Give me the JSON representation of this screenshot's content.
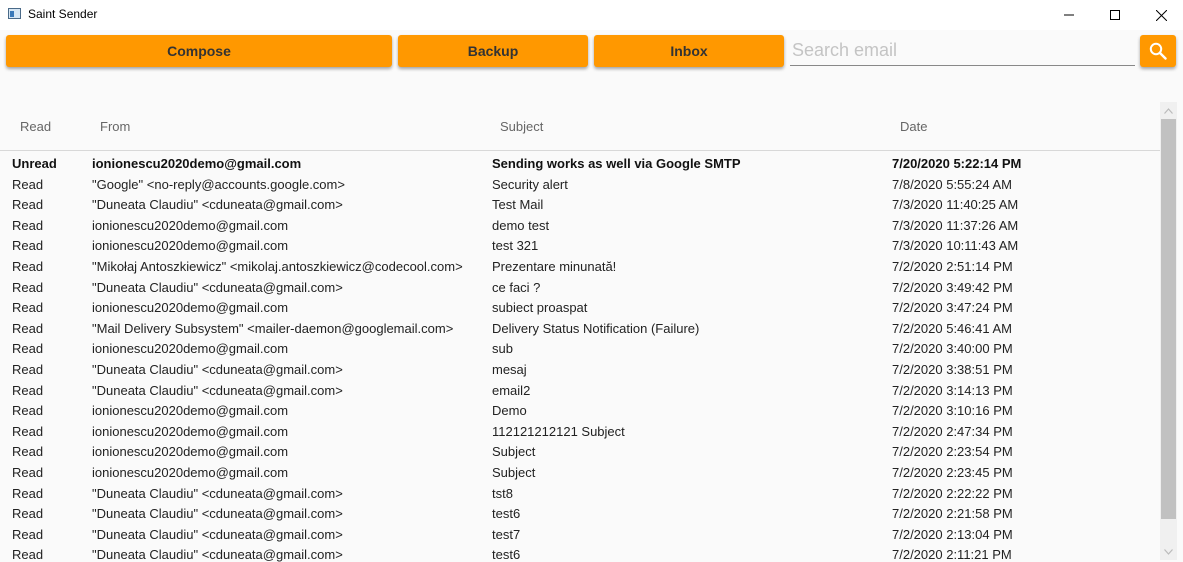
{
  "window": {
    "title": "Saint Sender"
  },
  "toolbar": {
    "compose_label": "Compose",
    "backup_label": "Backup",
    "inbox_label": "Inbox",
    "search_placeholder": "Search email",
    "search_value": ""
  },
  "colors": {
    "accent": "#ff9800"
  },
  "icons": {
    "search": "search-icon",
    "minimize": "minimize-icon",
    "maximize": "maximize-icon",
    "close": "close-icon"
  },
  "table": {
    "headers": {
      "read": "Read",
      "from": "From",
      "subject": "Subject",
      "date": "Date"
    },
    "rows": [
      {
        "read": "Unread",
        "from": "ionionescu2020demo@gmail.com",
        "subject": "Sending works as well via Google SMTP",
        "date": "7/20/2020 5:22:14 PM",
        "bold": true
      },
      {
        "read": "Read",
        "from": "\"Google\" <no-reply@accounts.google.com>",
        "subject": "Security alert",
        "date": "7/8/2020 5:55:24 AM"
      },
      {
        "read": "Read",
        "from": "\"Duneata Claudiu\" <cduneata@gmail.com>",
        "subject": "Test Mail",
        "date": "7/3/2020 11:40:25 AM"
      },
      {
        "read": "Read",
        "from": "ionionescu2020demo@gmail.com",
        "subject": "demo test",
        "date": "7/3/2020 11:37:26 AM"
      },
      {
        "read": "Read",
        "from": "ionionescu2020demo@gmail.com",
        "subject": "test 321",
        "date": "7/3/2020 10:11:43 AM"
      },
      {
        "read": "Read",
        "from": "\"Mikołaj Antoszkiewicz\" <mikolaj.antoszkiewicz@codecool.com>",
        "subject": "Prezentare minunată!",
        "date": "7/2/2020 2:51:14 PM"
      },
      {
        "read": "Read",
        "from": "\"Duneata Claudiu\" <cduneata@gmail.com>",
        "subject": "ce faci ?",
        "date": "7/2/2020 3:49:42 PM"
      },
      {
        "read": "Read",
        "from": "ionionescu2020demo@gmail.com",
        "subject": "subiect proaspat",
        "date": "7/2/2020 3:47:24 PM"
      },
      {
        "read": "Read",
        "from": "\"Mail Delivery Subsystem\" <mailer-daemon@googlemail.com>",
        "subject": "Delivery Status Notification (Failure)",
        "date": "7/2/2020 5:46:41 AM"
      },
      {
        "read": "Read",
        "from": "ionionescu2020demo@gmail.com",
        "subject": "sub",
        "date": "7/2/2020 3:40:00 PM"
      },
      {
        "read": "Read",
        "from": "\"Duneata Claudiu\" <cduneata@gmail.com>",
        "subject": "mesaj",
        "date": "7/2/2020 3:38:51 PM"
      },
      {
        "read": "Read",
        "from": "\"Duneata Claudiu\" <cduneata@gmail.com>",
        "subject": "email2",
        "date": "7/2/2020 3:14:13 PM"
      },
      {
        "read": "Read",
        "from": "ionionescu2020demo@gmail.com",
        "subject": "Demo",
        "date": "7/2/2020 3:10:16 PM"
      },
      {
        "read": "Read",
        "from": "ionionescu2020demo@gmail.com",
        "subject": "112121212121 Subject",
        "date": "7/2/2020 2:47:34 PM"
      },
      {
        "read": "Read",
        "from": "ionionescu2020demo@gmail.com",
        "subject": "Subject",
        "date": "7/2/2020 2:23:54 PM"
      },
      {
        "read": "Read",
        "from": "ionionescu2020demo@gmail.com",
        "subject": "Subject",
        "date": "7/2/2020 2:23:45 PM"
      },
      {
        "read": "Read",
        "from": "\"Duneata Claudiu\" <cduneata@gmail.com>",
        "subject": "tst8",
        "date": "7/2/2020 2:22:22 PM"
      },
      {
        "read": "Read",
        "from": "\"Duneata Claudiu\" <cduneata@gmail.com>",
        "subject": "test6",
        "date": "7/2/2020 2:21:58 PM"
      },
      {
        "read": "Read",
        "from": "\"Duneata Claudiu\" <cduneata@gmail.com>",
        "subject": "test7",
        "date": "7/2/2020 2:13:04 PM"
      },
      {
        "read": "Read",
        "from": "\"Duneata Claudiu\" <cduneata@gmail.com>",
        "subject": "test6",
        "date": "7/2/2020 2:11:21 PM"
      }
    ]
  }
}
